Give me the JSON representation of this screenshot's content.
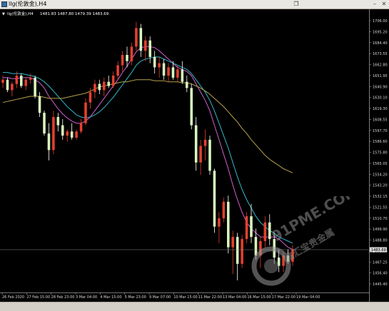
{
  "window": {
    "title": "llg(伦敦金),H4",
    "buttons": {
      "minimize": "–",
      "restore": "❐",
      "close": "✕"
    }
  },
  "chart_header": {
    "label": "llg(伦敦金),H4",
    "ohlc": "1481.83 1487.80 1479.39 1483.69"
  },
  "price_axis": {
    "ticks": [
      "1706.00",
      "1695.20",
      "1684.40",
      "1673.55",
      "1662.80",
      "1651.95",
      "1640.90",
      "1630.10",
      "1619.30",
      "1608.55",
      "1597.70",
      "1586.60",
      "1575.80",
      "1565.05",
      "1554.20",
      "1543.20",
      "1532.15",
      "1521.55",
      "1510.70",
      "1499.90",
      "1488.80",
      "1478.00",
      "1467.25",
      "1456.40",
      "1445.40"
    ],
    "current_price": "1483.69"
  },
  "time_axis": {
    "labels": [
      "26 Feb 2020",
      "27 Feb 15:00",
      "28 Feb 23:00",
      "3 Mar 04:00",
      "4 Mar 15:00",
      "5 Mar 23:00",
      "9 Mar 07:00",
      "10 Mar 15:00",
      "11 Mar 22:00",
      "13 Mar 04:00",
      "16 Mar 15:00",
      "17 Mar 22:00",
      "19 Mar 04:00"
    ]
  },
  "watermark": {
    "brand": "91PME.COM",
    "cn": "鑫汇宝贵金属"
  },
  "chart_data": {
    "type": "candlestick",
    "title": "",
    "xlabel": "",
    "ylabel": "",
    "ylim": [
      1443,
      1712
    ],
    "candles": [
      [
        1645,
        1652,
        1640,
        1648
      ],
      [
        1648,
        1650,
        1636,
        1638
      ],
      [
        1638,
        1646,
        1632,
        1644
      ],
      [
        1644,
        1656,
        1640,
        1652
      ],
      [
        1652,
        1654,
        1640,
        1642
      ],
      [
        1642,
        1650,
        1638,
        1648
      ],
      [
        1648,
        1654,
        1644,
        1650
      ],
      [
        1650,
        1652,
        1630,
        1632
      ],
      [
        1632,
        1636,
        1612,
        1616
      ],
      [
        1616,
        1618,
        1594,
        1596
      ],
      [
        1596,
        1606,
        1570,
        1580
      ],
      [
        1580,
        1618,
        1576,
        1612
      ],
      [
        1612,
        1616,
        1598,
        1604
      ],
      [
        1604,
        1610,
        1590,
        1594
      ],
      [
        1594,
        1600,
        1588,
        1598
      ],
      [
        1598,
        1606,
        1590,
        1592
      ],
      [
        1592,
        1600,
        1590,
        1598
      ],
      [
        1598,
        1610,
        1596,
        1606
      ],
      [
        1606,
        1630,
        1604,
        1626
      ],
      [
        1626,
        1640,
        1620,
        1636
      ],
      [
        1636,
        1648,
        1630,
        1644
      ],
      [
        1644,
        1648,
        1634,
        1638
      ],
      [
        1638,
        1650,
        1632,
        1646
      ],
      [
        1646,
        1652,
        1640,
        1642
      ],
      [
        1642,
        1656,
        1640,
        1652
      ],
      [
        1652,
        1666,
        1648,
        1662
      ],
      [
        1662,
        1676,
        1656,
        1672
      ],
      [
        1672,
        1680,
        1660,
        1666
      ],
      [
        1666,
        1684,
        1662,
        1680
      ],
      [
        1680,
        1704,
        1676,
        1698
      ],
      [
        1698,
        1702,
        1670,
        1676
      ],
      [
        1676,
        1690,
        1666,
        1686
      ],
      [
        1686,
        1690,
        1664,
        1670
      ],
      [
        1670,
        1676,
        1654,
        1660
      ],
      [
        1660,
        1670,
        1650,
        1664
      ],
      [
        1664,
        1668,
        1648,
        1652
      ],
      [
        1652,
        1664,
        1646,
        1660
      ],
      [
        1660,
        1666,
        1648,
        1650
      ],
      [
        1650,
        1662,
        1646,
        1658
      ],
      [
        1658,
        1666,
        1644,
        1646
      ],
      [
        1646,
        1652,
        1636,
        1640
      ],
      [
        1640,
        1644,
        1600,
        1604
      ],
      [
        1604,
        1612,
        1560,
        1568
      ],
      [
        1568,
        1590,
        1556,
        1584
      ],
      [
        1584,
        1600,
        1570,
        1590
      ],
      [
        1590,
        1594,
        1556,
        1560
      ],
      [
        1560,
        1562,
        1500,
        1506
      ],
      [
        1506,
        1520,
        1490,
        1514
      ],
      [
        1514,
        1534,
        1510,
        1530
      ],
      [
        1530,
        1536,
        1480,
        1486
      ],
      [
        1486,
        1502,
        1460,
        1496
      ],
      [
        1496,
        1500,
        1454,
        1470
      ],
      [
        1470,
        1498,
        1466,
        1494
      ],
      [
        1494,
        1520,
        1490,
        1516
      ],
      [
        1516,
        1528,
        1490,
        1496
      ],
      [
        1496,
        1504,
        1474,
        1478
      ],
      [
        1478,
        1496,
        1466,
        1492
      ],
      [
        1492,
        1516,
        1486,
        1510
      ],
      [
        1510,
        1518,
        1488,
        1494
      ],
      [
        1494,
        1500,
        1470,
        1476
      ],
      [
        1476,
        1484,
        1462,
        1468
      ],
      [
        1468,
        1482,
        1462,
        1478
      ],
      [
        1478,
        1484,
        1470,
        1472
      ],
      [
        1472,
        1488,
        1468,
        1484
      ]
    ],
    "ma_lines": [
      {
        "color": "#d15fd1",
        "values": [
          1650,
          1650,
          1649,
          1649,
          1650,
          1650,
          1650,
          1648,
          1645,
          1640,
          1632,
          1626,
          1620,
          1615,
          1611,
          1608,
          1606,
          1606,
          1608,
          1612,
          1618,
          1624,
          1630,
          1636,
          1642,
          1648,
          1655,
          1661,
          1668,
          1675,
          1679,
          1680,
          1680,
          1679,
          1676,
          1672,
          1668,
          1664,
          1660,
          1658,
          1656,
          1652,
          1644,
          1636,
          1628,
          1618,
          1604,
          1590,
          1576,
          1562,
          1546,
          1532,
          1520,
          1510,
          1504,
          1500,
          1496,
          1496,
          1496,
          1496,
          1494,
          1490,
          1486,
          1484
        ]
      },
      {
        "color": "#34b7c9",
        "values": [
          1655,
          1655,
          1654,
          1654,
          1654,
          1653,
          1652,
          1651,
          1649,
          1646,
          1642,
          1637,
          1632,
          1627,
          1622,
          1618,
          1614,
          1612,
          1611,
          1612,
          1614,
          1617,
          1621,
          1626,
          1631,
          1637,
          1643,
          1649,
          1655,
          1662,
          1666,
          1668,
          1669,
          1670,
          1670,
          1668,
          1666,
          1664,
          1662,
          1660,
          1658,
          1654,
          1648,
          1642,
          1636,
          1628,
          1618,
          1606,
          1594,
          1582,
          1568,
          1554,
          1542,
          1532,
          1524,
          1516,
          1510,
          1506,
          1502,
          1500,
          1496,
          1494,
          1492,
          1490
        ]
      },
      {
        "color": "#b5a24a",
        "values": [
          1626,
          1627,
          1628,
          1629,
          1630,
          1631,
          1632,
          1632,
          1632,
          1631,
          1630,
          1630,
          1630,
          1630,
          1631,
          1632,
          1633,
          1634,
          1635,
          1637,
          1639,
          1641,
          1642,
          1643,
          1644,
          1645,
          1646,
          1646,
          1647,
          1648,
          1648,
          1648,
          1648,
          1647,
          1647,
          1647,
          1646,
          1646,
          1646,
          1645,
          1645,
          1644,
          1642,
          1640,
          1637,
          1634,
          1630,
          1626,
          1622,
          1617,
          1612,
          1607,
          1601,
          1596,
          1590,
          1585,
          1580,
          1575,
          1571,
          1568,
          1565,
          1562,
          1560,
          1558
        ]
      }
    ],
    "last_price": 1483.69
  }
}
